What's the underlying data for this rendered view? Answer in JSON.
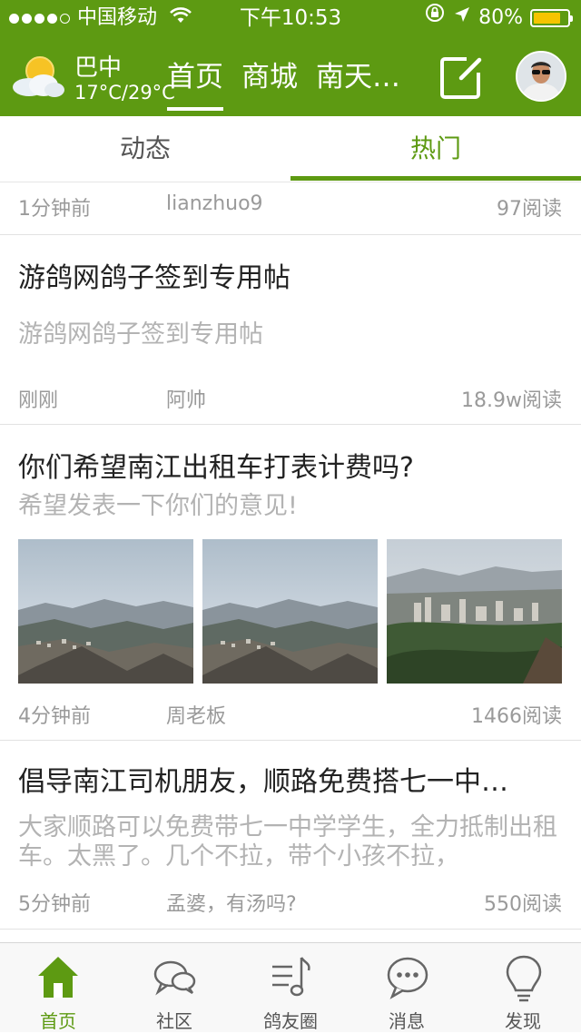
{
  "status_bar": {
    "carrier": "中国移动",
    "time": "下午10:53",
    "battery": "80%",
    "battery_level": 0.8
  },
  "header": {
    "weather": {
      "city": "巴中",
      "temp": "17°C/29°C",
      "icon": "partly-cloudy-icon"
    },
    "tabs": [
      {
        "label": "首页",
        "active": true
      },
      {
        "label": "商城",
        "active": false
      },
      {
        "label": "南天…",
        "active": false
      }
    ],
    "compose_icon": "compose-icon",
    "avatar_icon": "user-avatar"
  },
  "subtabs": [
    {
      "label": "动态",
      "active": false
    },
    {
      "label": "热门",
      "active": true
    }
  ],
  "feed": {
    "top_meta": {
      "time": "1分钟前",
      "author": "lianzhuo9",
      "reads": "97阅读"
    },
    "posts": [
      {
        "title": "游鸽网鸽子签到专用帖",
        "excerpt": "游鸽网鸽子签到专用帖",
        "time": "刚刚",
        "author": "阿帅",
        "reads": "18.9w阅读"
      },
      {
        "title": "你们希望南江出租车打表计费吗?",
        "excerpt": "希望发表一下你们的意见!",
        "images": [
          "mountain-town-photo",
          "mountain-town-photo",
          "city-hillside-photo"
        ],
        "time": "4分钟前",
        "author": "周老板",
        "reads": "1466阅读"
      },
      {
        "title": "倡导南江司机朋友，顺路免费搭七一中…",
        "excerpt": "大家顺路可以免费带七一中学学生，全力抵制出租车。太黑了。几个不拉，带个小孩不拉，",
        "time": "5分钟前",
        "author": "孟婆，有汤吗?",
        "reads": "550阅读"
      }
    ]
  },
  "bottom_nav": [
    {
      "label": "首页",
      "icon": "home-icon",
      "active": true
    },
    {
      "label": "社区",
      "icon": "chat-bubbles-icon",
      "active": false
    },
    {
      "label": "鸽友圈",
      "icon": "music-list-icon",
      "active": false
    },
    {
      "label": "消息",
      "icon": "message-icon",
      "active": false
    },
    {
      "label": "发现",
      "icon": "lightbulb-icon",
      "active": false
    }
  ],
  "colors": {
    "brand_green": "#5d9a12",
    "battery": "#f5c400"
  }
}
